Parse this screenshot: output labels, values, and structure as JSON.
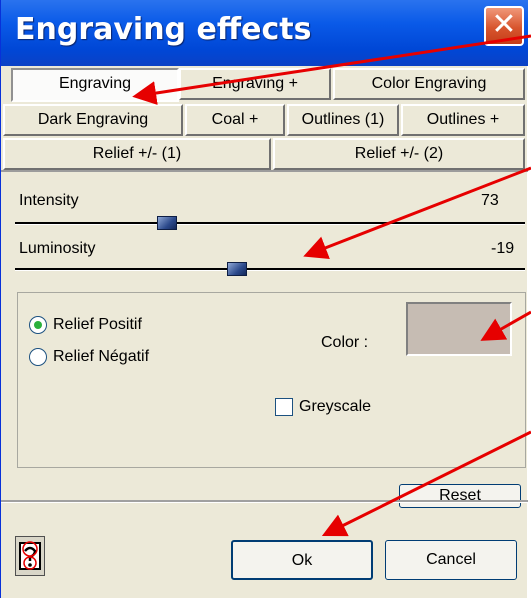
{
  "window": {
    "title": "Engraving effects",
    "close_glyph": "✕"
  },
  "tabs": [
    {
      "label": "Engraving",
      "active": true
    },
    {
      "label": "Engraving +",
      "active": false
    },
    {
      "label": "Color Engraving",
      "active": false
    },
    {
      "label": "Dark Engraving",
      "active": false
    },
    {
      "label": "Coal +",
      "active": false
    },
    {
      "label": "Outlines (1)",
      "active": false
    },
    {
      "label": "Outlines +",
      "active": false
    },
    {
      "label": "Relief +/- (1)",
      "active": false
    },
    {
      "label": "Relief +/- (2)",
      "active": false
    }
  ],
  "sliders": {
    "intensity": {
      "label": "Intensity",
      "value": "73"
    },
    "luminosity": {
      "label": "Luminosity",
      "value": "-19"
    }
  },
  "options": {
    "relief_positif": "Relief Positif",
    "relief_negatif": "Relief Négatif",
    "selected": "relief_positif",
    "color_label": "Color :",
    "color_value": "#c6bcb3",
    "greyscale_label": "Greyscale",
    "greyscale_checked": false
  },
  "buttons": {
    "reset": "Reset",
    "ok": "Ok",
    "cancel": "Cancel"
  },
  "icons": {
    "help": "help-icon",
    "close": "close-icon",
    "annotation": "red-arrow-icon"
  },
  "colors": {
    "titlebar": "#0a5ae8",
    "annotation_arrow": "#e60000"
  }
}
